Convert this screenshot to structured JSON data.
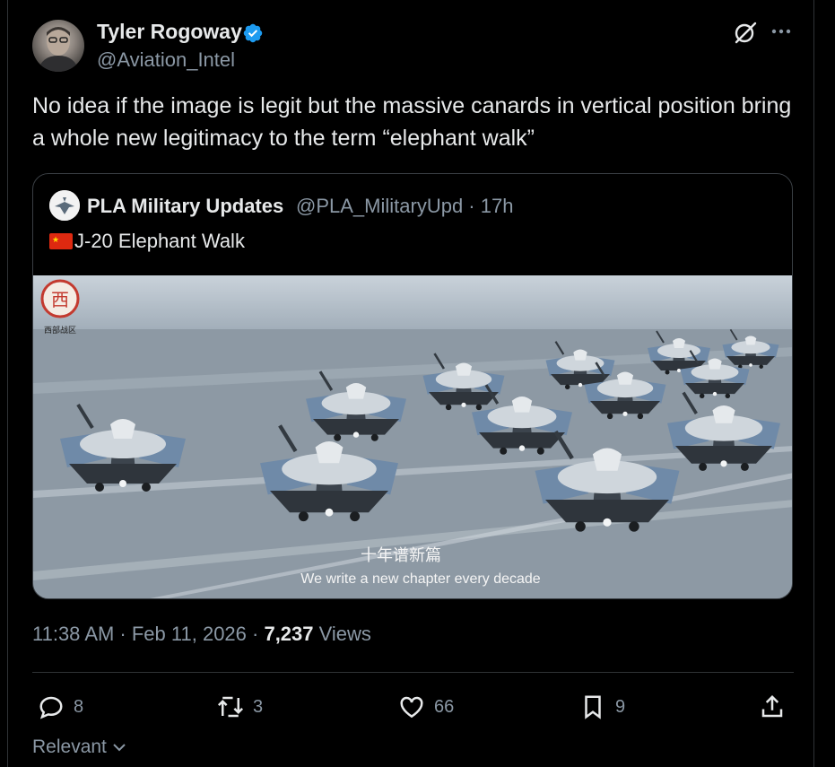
{
  "author": {
    "name": "Tyler Rogoway",
    "handle": "@Aviation_Intel",
    "verified": true
  },
  "tweet": {
    "text": "No idea if the image is legit but the massive canards in vertical position bring a whole new legitimacy to the term “elephant walk”"
  },
  "quoted": {
    "name": "PLA Military Updates",
    "handle_time": "@PLA_MilitaryUpd · 17h",
    "text": "J-20 Elephant Walk",
    "flag": "china-flag",
    "image": {
      "caption_cn": "十年谱新篇",
      "caption_en": "We write a new chapter every decade",
      "watermark_text": "西部战区"
    }
  },
  "meta": {
    "time_date": "11:38 AM · Feb 11, 2026 · ",
    "views_count": "7,237",
    "views_label": " Views"
  },
  "actions": {
    "replies": "8",
    "reposts": "3",
    "likes": "66",
    "bookmarks": "9"
  },
  "sort": {
    "label": "Relevant"
  },
  "colors": {
    "background": "#000000",
    "text": "#e7e9ea",
    "muted": "#8b98a5",
    "verified": "#1d9bf0",
    "border": "#2f3336"
  },
  "icons": [
    "verified-badge-icon",
    "grok-icon",
    "more-icon",
    "reply-icon",
    "repost-icon",
    "like-icon",
    "bookmark-icon",
    "share-icon",
    "chevron-down-icon"
  ]
}
